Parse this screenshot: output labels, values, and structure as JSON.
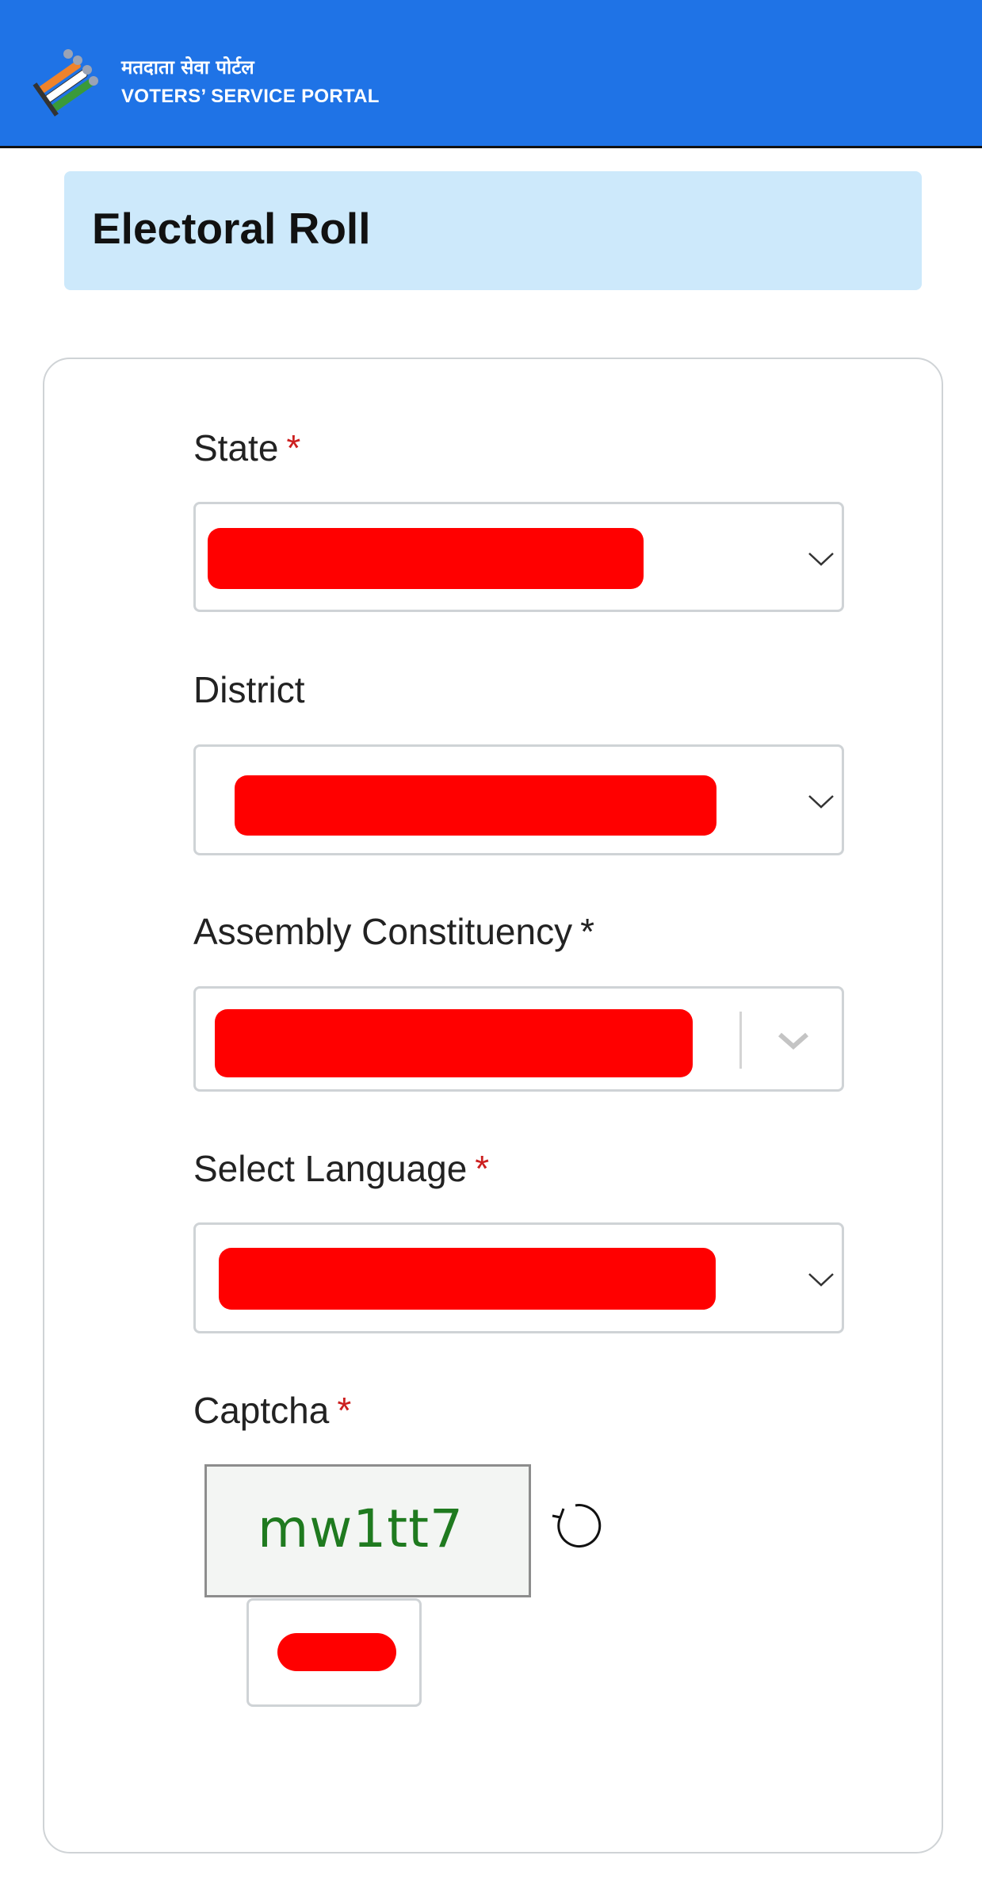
{
  "header": {
    "title_hindi": "मतदाता सेवा पोर्टल",
    "title_english": "VOTERS’ SERVICE PORTAL",
    "logo_icon": "eci-logo-icon",
    "background_color": "#1f73e6"
  },
  "page": {
    "title": "Electoral Roll",
    "title_bg_color": "#cde9fb"
  },
  "form": {
    "state": {
      "label": "State",
      "required_marker": "*",
      "value_redacted": true
    },
    "district": {
      "label": "District",
      "value_redacted": true
    },
    "assembly_constituency": {
      "label": "Assembly Constituency",
      "required_marker": "*",
      "value_redacted": true
    },
    "language": {
      "label": "Select Language",
      "required_marker": "*",
      "value_redacted": true
    },
    "captcha": {
      "label": "Captcha",
      "required_marker": "*",
      "image_text": "mw1tt7",
      "refresh_icon": "refresh-icon",
      "input_redacted": true
    },
    "required_color": "#cc1f1f",
    "redaction_color": "#ff0000"
  }
}
